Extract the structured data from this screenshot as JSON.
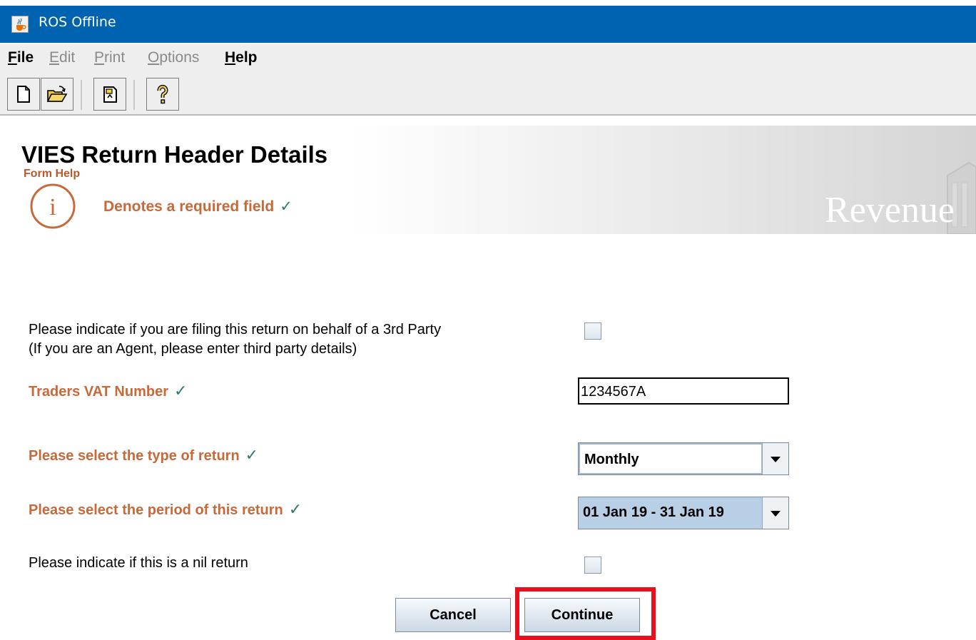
{
  "window": {
    "title": "ROS Offline",
    "icon": "java-cup-icon"
  },
  "menu": [
    {
      "label": "File",
      "mnemonic": "F",
      "rest": "ile",
      "enabled": true
    },
    {
      "label": "Edit",
      "mnemonic": "E",
      "rest": "dit",
      "enabled": false
    },
    {
      "label": "Print",
      "mnemonic": "P",
      "rest": "rint",
      "enabled": false
    },
    {
      "label": "Options",
      "mnemonic": "O",
      "rest": "ptions",
      "enabled": false
    },
    {
      "label": "Help",
      "mnemonic": "H",
      "rest": "elp",
      "enabled": true
    }
  ],
  "toolbar": {
    "icons": [
      "new-document-icon",
      "open-folder-icon",
      "load-file-icon",
      "help-question-icon"
    ]
  },
  "header": {
    "title": "VIES Return Header Details",
    "form_help": "Form Help",
    "required_note": "Denotes a required field",
    "check": "✓",
    "logo": "Revenue"
  },
  "form": {
    "third_party_line1": "Please indicate if you are filing this return on behalf of a 3rd Party",
    "third_party_line2": "(If you are an Agent, please enter third party details)",
    "third_party_checked": false,
    "vat_label": "Traders VAT Number",
    "vat_value": "1234567A",
    "type_label": "Please select the type of return",
    "type_value": "Monthly",
    "period_label": "Please select the period of this return",
    "period_value": "01 Jan 19 - 31 Jan 19",
    "nil_label": "Please indicate if this is a nil return",
    "nil_checked": false
  },
  "buttons": {
    "cancel": "Cancel",
    "continue": "Continue"
  },
  "colors": {
    "titlebar": "#0063b1",
    "required_label": "#c8693a",
    "check": "#2e7a70",
    "highlight": "#e8101f"
  }
}
